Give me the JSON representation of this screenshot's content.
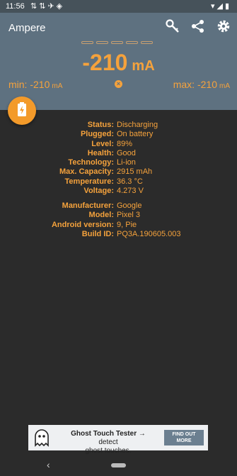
{
  "status_bar": {
    "time": "11:56",
    "left_icons": [
      "notification-icon",
      "notification-icon",
      "notification-icon",
      "notification-icon"
    ],
    "right_icons": [
      "wifi-icon",
      "signal-icon",
      "battery-icon"
    ]
  },
  "app_bar": {
    "title": "Ampere",
    "icons": [
      "key-icon",
      "share-icon",
      "settings-icon"
    ]
  },
  "meter": {
    "current_value": "-210",
    "current_unit": "mA",
    "min_label": "min:",
    "min_value": "-210",
    "min_unit": "mA",
    "max_label": "max:",
    "max_value": "-210",
    "max_unit": "mA",
    "reset_glyph": "×",
    "accent_color": "#f5a23c"
  },
  "battery_info": [
    {
      "key": "Status:",
      "value": "Discharging"
    },
    {
      "key": "Plugged:",
      "value": "On battery"
    },
    {
      "key": "Level:",
      "value": "89%"
    },
    {
      "key": "Health:",
      "value": "Good"
    },
    {
      "key": "Technology:",
      "value": "Li-ion"
    },
    {
      "key": "Max. Capacity:",
      "value": "2915 mAh"
    },
    {
      "key": "Temperature:",
      "value": "36.3 °C"
    },
    {
      "key": "Voltage:",
      "value": "4.273 V"
    }
  ],
  "device_info": [
    {
      "key": "Manufacturer:",
      "value": "Google"
    },
    {
      "key": "Model:",
      "value": "Pixel 3"
    },
    {
      "key": "Android version:",
      "value": "9, Pie"
    },
    {
      "key": "Build ID:",
      "value": "PQ3A.190605.003"
    }
  ],
  "ad": {
    "title": "Ghost Touch Tester",
    "arrow": "→",
    "line1_rest": "detect",
    "line2": "ghost touches.",
    "cta_line1": "FIND OUT",
    "cta_line2": "MORE"
  },
  "nav": {
    "back_glyph": "‹"
  }
}
